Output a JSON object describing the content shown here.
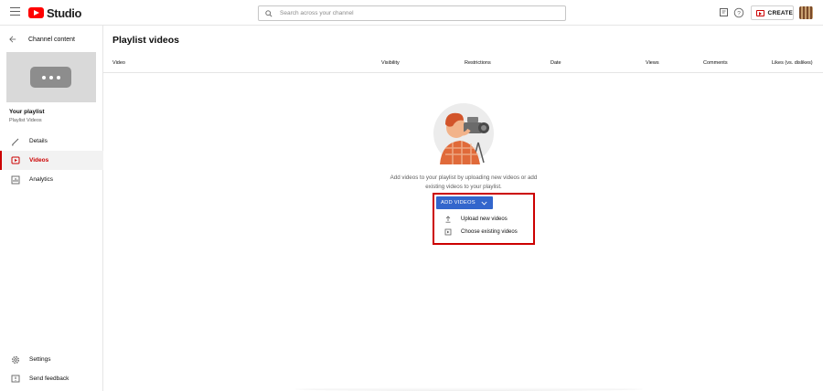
{
  "header": {
    "logo_text": "Studio",
    "search_placeholder": "Search across your channel",
    "create_label": "CREATE"
  },
  "sidebar": {
    "back_label": "Channel content",
    "playlist_title": "Your playlist",
    "playlist_subtitle": "Playlist Videos",
    "items": [
      {
        "label": "Details",
        "icon": "pencil-icon"
      },
      {
        "label": "Videos",
        "icon": "video-icon",
        "active": true
      },
      {
        "label": "Analytics",
        "icon": "analytics-icon"
      }
    ],
    "bottom_items": [
      {
        "label": "Settings",
        "icon": "gear-icon"
      },
      {
        "label": "Send feedback",
        "icon": "feedback-icon"
      }
    ]
  },
  "main": {
    "title": "Playlist videos",
    "columns": [
      "Video",
      "Visibility",
      "Restrictions",
      "Date",
      "Views",
      "Comments",
      "Likes (vs. dislikes)"
    ],
    "empty_message_line1": "Add videos to your playlist by uploading new videos or add",
    "empty_message_line2": "existing videos to your playlist.",
    "add_button_label": "ADD VIDEOS",
    "menu": [
      {
        "label": "Upload new videos",
        "icon": "upload-icon"
      },
      {
        "label": "Choose existing videos",
        "icon": "video-library-icon"
      }
    ]
  },
  "colors": {
    "accent_red": "#cc0000",
    "button_blue": "#3366cc"
  }
}
